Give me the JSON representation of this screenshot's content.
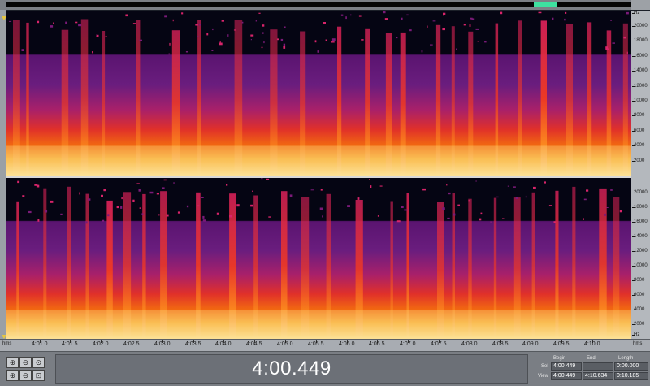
{
  "colors": {
    "spectrogram_bg": "#050513",
    "accent": "#3ee0a0",
    "playhead": "#e6c740"
  },
  "overview": {
    "view_fraction": 0.049
  },
  "freq_axis": {
    "top_unit": "Hz",
    "bottom_unit": "Hz",
    "ticks": [
      "20000",
      "18000",
      "16000",
      "14000",
      "12000",
      "10000",
      "8000",
      "6000",
      "4000",
      "2000"
    ]
  },
  "time_axis": {
    "left_unit": "hms",
    "right_unit": "hms",
    "ticks": [
      "4:01.0",
      "4:01.5",
      "4:02.0",
      "4:02.5",
      "4:03.0",
      "4:03.5",
      "4:04.0",
      "4:04.5",
      "4:05.0",
      "4:05.5",
      "4:06.0",
      "4:06.5",
      "4:07.0",
      "4:07.5",
      "4:08.0",
      "4:08.5",
      "4:09.0",
      "4:09.5",
      "4:10.0"
    ]
  },
  "zoom_buttons": [
    {
      "icon": "zoom-in-horizontal-icon",
      "glyph": "⊕"
    },
    {
      "icon": "zoom-out-horizontal-icon",
      "glyph": "⊖"
    },
    {
      "icon": "zoom-full-icon",
      "glyph": "⊙"
    },
    {
      "icon": "zoom-in-vertical-icon",
      "glyph": "⊕"
    },
    {
      "icon": "zoom-out-vertical-icon",
      "glyph": "⊖"
    },
    {
      "icon": "zoom-selection-icon",
      "glyph": "⊡"
    }
  ],
  "time_display": "4:00.449",
  "selection_panel": {
    "headers": {
      "begin": "Begin",
      "end": "End",
      "length": "Length"
    },
    "sel": {
      "label": "Sel",
      "begin": "4:00.449",
      "end": "",
      "length": "0:00.000"
    },
    "view": {
      "label": "View",
      "begin": "4:00.449",
      "end": "4:10.634",
      "length": "0:10.185"
    }
  }
}
